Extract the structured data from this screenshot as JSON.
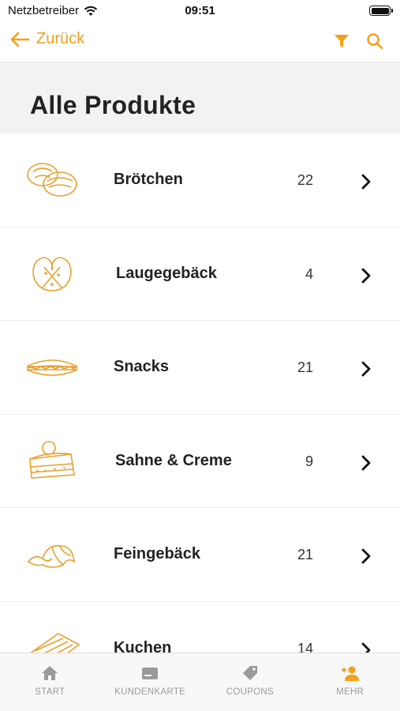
{
  "status_bar": {
    "carrier": "Netzbetreiber",
    "time": "09:51"
  },
  "nav": {
    "back_label": "Zurück"
  },
  "page_title": "Alle Produkte",
  "accent_color": "#f5a01a",
  "products": [
    {
      "name": "Brötchen",
      "count": "22",
      "icon": "bread-rolls-icon"
    },
    {
      "name": "Laugegebäck",
      "count": "4",
      "icon": "pretzel-icon"
    },
    {
      "name": "Snacks",
      "count": "21",
      "icon": "sandwich-icon"
    },
    {
      "name": "Sahne & Creme",
      "count": "9",
      "icon": "cake-slice-icon"
    },
    {
      "name": "Feingebäck",
      "count": "21",
      "icon": "croissant-icon"
    },
    {
      "name": "Kuchen",
      "count": "14",
      "icon": "sheet-cake-icon"
    }
  ],
  "tabs": [
    {
      "label": "START",
      "icon": "home-icon"
    },
    {
      "label": "KUNDENKARTE",
      "icon": "card-icon"
    },
    {
      "label": "COUPONS",
      "icon": "tag-icon"
    },
    {
      "label": "MEHR",
      "icon": "add-person-icon"
    }
  ]
}
